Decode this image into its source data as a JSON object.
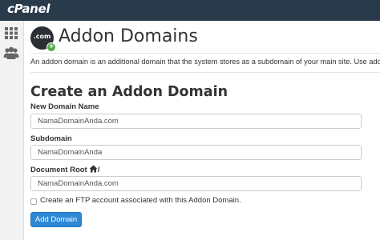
{
  "app": {
    "logo_text": "cPanel",
    "header_color": "#293a4a",
    "accent_color": "#2d88d6"
  },
  "sidebar": {
    "items": [
      {
        "icon": "grid-icon"
      },
      {
        "icon": "users-icon"
      }
    ]
  },
  "page": {
    "icon_text": ".com",
    "icon_badge": "+",
    "title": "Addon Domains",
    "description": "An addon domain is an additional domain that the system stores as a subdomain of your main site. Use addon d"
  },
  "form": {
    "section_title": "Create an Addon Domain",
    "new_domain": {
      "label": "New Domain Name",
      "value": "NamaDomainAnda.com"
    },
    "subdomain": {
      "label": "Subdomain",
      "value": "NamaDomainAnda"
    },
    "document_root": {
      "label": "Document Root",
      "suffix": "/",
      "value": "NamaDomainAnda.com"
    },
    "ftp_checkbox": {
      "label": "Create an FTP account associated with this Addon Domain.",
      "checked": false
    },
    "submit_label": "Add Domain"
  }
}
